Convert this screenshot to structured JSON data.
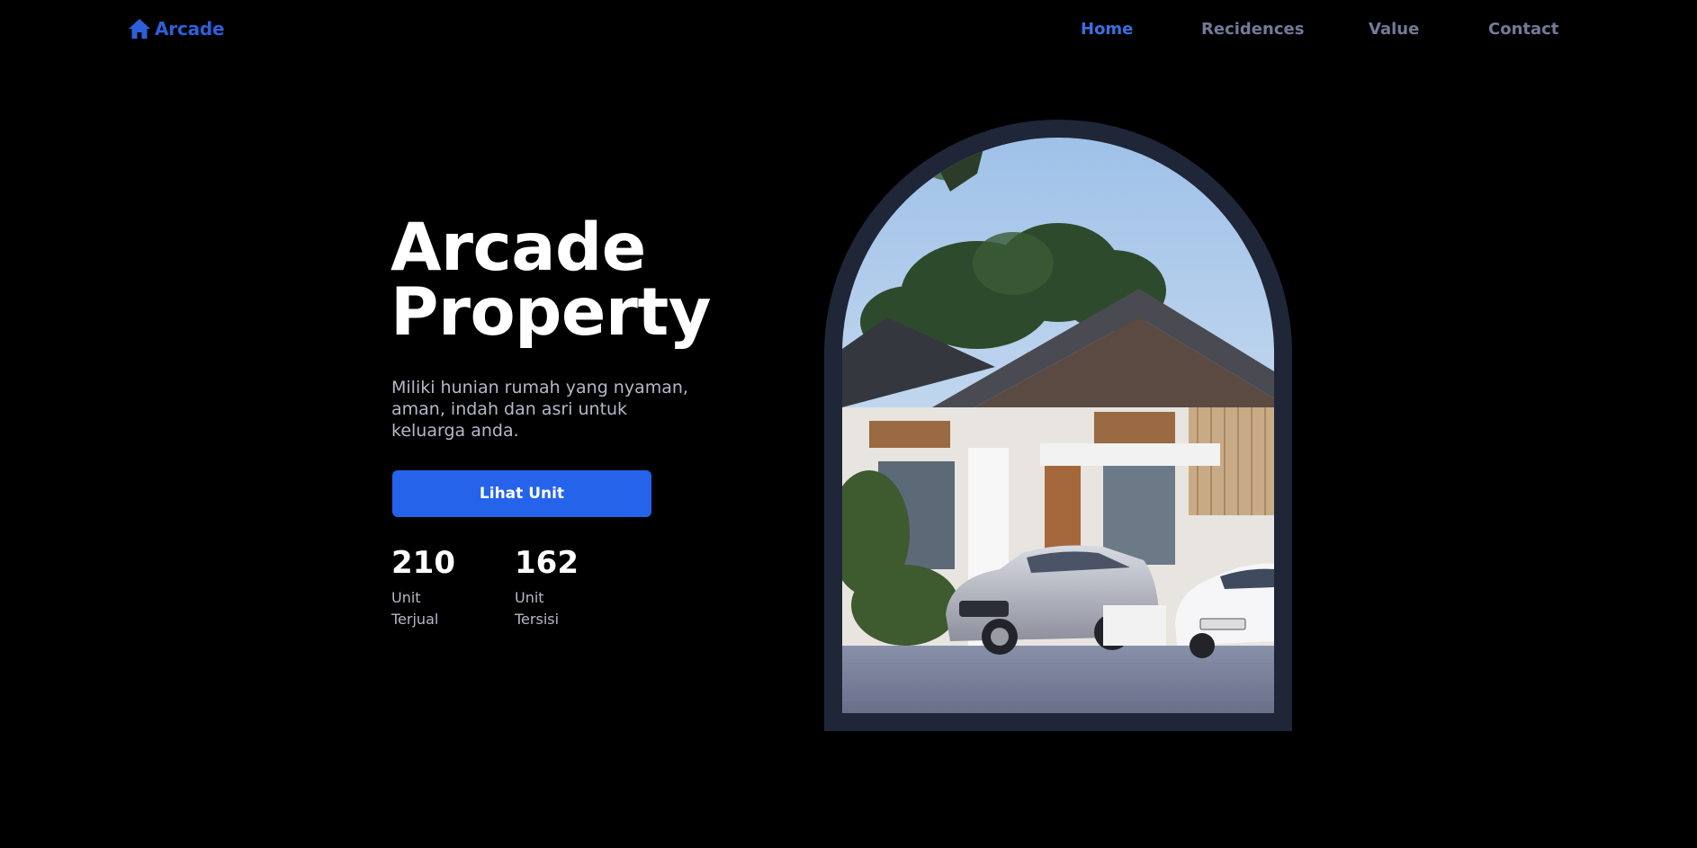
{
  "header": {
    "logo_icon": "home-icon",
    "logo_text": "Arcade",
    "nav": [
      {
        "label": "Home",
        "active": true
      },
      {
        "label": "Recidences",
        "active": false
      },
      {
        "label": "Value",
        "active": false
      },
      {
        "label": "Contact",
        "active": false
      }
    ]
  },
  "hero": {
    "title_line1": "Arcade",
    "title_line2": "Property",
    "description": "Miliki hunian rumah yang nyaman, aman, indah dan asri untuk keluarga anda.",
    "cta_label": "Lihat Unit",
    "stats": [
      {
        "number": "210",
        "label_line1": "Unit",
        "label_line2": "Terjual"
      },
      {
        "number": "162",
        "label_line1": "Unit",
        "label_line2": "Tersisi"
      }
    ],
    "image_subject": "modern-house-with-cars-photo"
  },
  "colors": {
    "background": "#000000",
    "accent": "#2563eb",
    "nav_active": "#3b6fe0",
    "nav_inactive": "#737a99",
    "logo": "#2f5fd8",
    "text_primary": "#ffffff",
    "text_muted": "#b5b8c7",
    "arch_frame": "#1e2638"
  }
}
